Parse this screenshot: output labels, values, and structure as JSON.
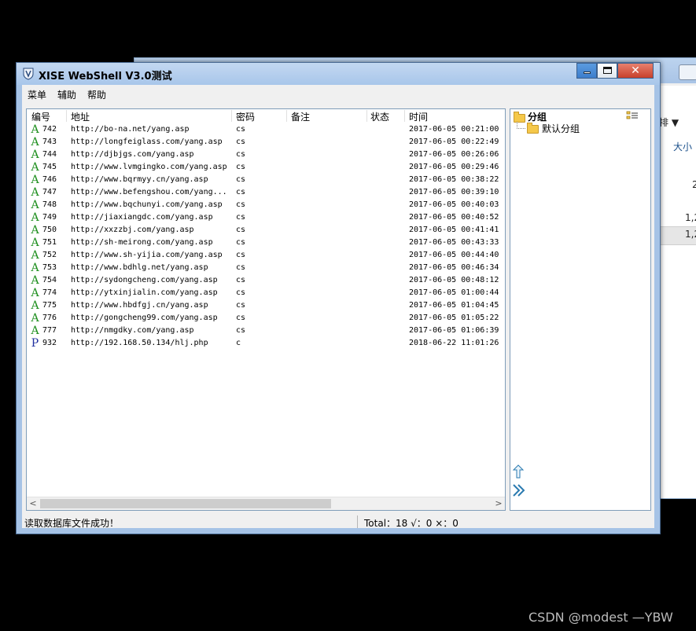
{
  "background_window": {
    "toolbar_text": "排 ▼",
    "size_header": "大小",
    "values": [
      "2",
      "1,2",
      "1,2"
    ]
  },
  "window": {
    "title": "XISE WebShell V3.0测试"
  },
  "menu": [
    "菜单",
    "辅助",
    "帮助"
  ],
  "columns": [
    "编号",
    "地址",
    "密码",
    "备注",
    "状态",
    "时间"
  ],
  "rows": [
    {
      "type": "A",
      "id": "742",
      "url": "http://bo-na.net/yang.asp",
      "pwd": "cs",
      "note": "",
      "status": "",
      "time": "2017-06-05 00:21:00"
    },
    {
      "type": "A",
      "id": "743",
      "url": "http://longfeiglass.com/yang.asp",
      "pwd": "cs",
      "note": "",
      "status": "",
      "time": "2017-06-05 00:22:49"
    },
    {
      "type": "A",
      "id": "744",
      "url": "http://djbjgs.com/yang.asp",
      "pwd": "cs",
      "note": "",
      "status": "",
      "time": "2017-06-05 00:26:06"
    },
    {
      "type": "A",
      "id": "745",
      "url": "http://www.lvmgingko.com/yang.asp",
      "pwd": "cs",
      "note": "",
      "status": "",
      "time": "2017-06-05 00:29:46"
    },
    {
      "type": "A",
      "id": "746",
      "url": "http://www.bqrmyy.cn/yang.asp",
      "pwd": "cs",
      "note": "",
      "status": "",
      "time": "2017-06-05 00:38:22"
    },
    {
      "type": "A",
      "id": "747",
      "url": "http://www.befengshou.com/yang...",
      "pwd": "cs",
      "note": "",
      "status": "",
      "time": "2017-06-05 00:39:10"
    },
    {
      "type": "A",
      "id": "748",
      "url": "http://www.bqchunyi.com/yang.asp",
      "pwd": "cs",
      "note": "",
      "status": "",
      "time": "2017-06-05 00:40:03"
    },
    {
      "type": "A",
      "id": "749",
      "url": "http://jiaxiangdc.com/yang.asp",
      "pwd": "cs",
      "note": "",
      "status": "",
      "time": "2017-06-05 00:40:52"
    },
    {
      "type": "A",
      "id": "750",
      "url": "http://xxzzbj.com/yang.asp",
      "pwd": "cs",
      "note": "",
      "status": "",
      "time": "2017-06-05 00:41:41"
    },
    {
      "type": "A",
      "id": "751",
      "url": "http://sh-meirong.com/yang.asp",
      "pwd": "cs",
      "note": "",
      "status": "",
      "time": "2017-06-05 00:43:33"
    },
    {
      "type": "A",
      "id": "752",
      "url": "http://www.sh-yijia.com/yang.asp",
      "pwd": "cs",
      "note": "",
      "status": "",
      "time": "2017-06-05 00:44:40"
    },
    {
      "type": "A",
      "id": "753",
      "url": "http://www.bdhlg.net/yang.asp",
      "pwd": "cs",
      "note": "",
      "status": "",
      "time": "2017-06-05 00:46:34"
    },
    {
      "type": "A",
      "id": "754",
      "url": "http://sydongcheng.com/yang.asp",
      "pwd": "cs",
      "note": "",
      "status": "",
      "time": "2017-06-05 00:48:12"
    },
    {
      "type": "A",
      "id": "774",
      "url": "http://ytxinjialin.com/yang.asp",
      "pwd": "cs",
      "note": "",
      "status": "",
      "time": "2017-06-05 01:00:44"
    },
    {
      "type": "A",
      "id": "775",
      "url": "http://www.hbdfgj.cn/yang.asp",
      "pwd": "cs",
      "note": "",
      "status": "",
      "time": "2017-06-05 01:04:45"
    },
    {
      "type": "A",
      "id": "776",
      "url": "http://gongcheng99.com/yang.asp",
      "pwd": "cs",
      "note": "",
      "status": "",
      "time": "2017-06-05 01:05:22"
    },
    {
      "type": "A",
      "id": "777",
      "url": "http://nmgdky.com/yang.asp",
      "pwd": "cs",
      "note": "",
      "status": "",
      "time": "2017-06-05 01:06:39"
    },
    {
      "type": "P",
      "id": "932",
      "url": "http://192.168.50.134/hlj.php",
      "pwd": "c",
      "note": "",
      "status": "",
      "time": "2018-06-22 11:01:26"
    }
  ],
  "group_panel": {
    "title": "分组",
    "default_group": "默认分组"
  },
  "status": {
    "message": "读取数据库文件成功！",
    "summary": "Total：18  √：0  ×：0"
  },
  "watermark": "CSDN @modest —YBW"
}
